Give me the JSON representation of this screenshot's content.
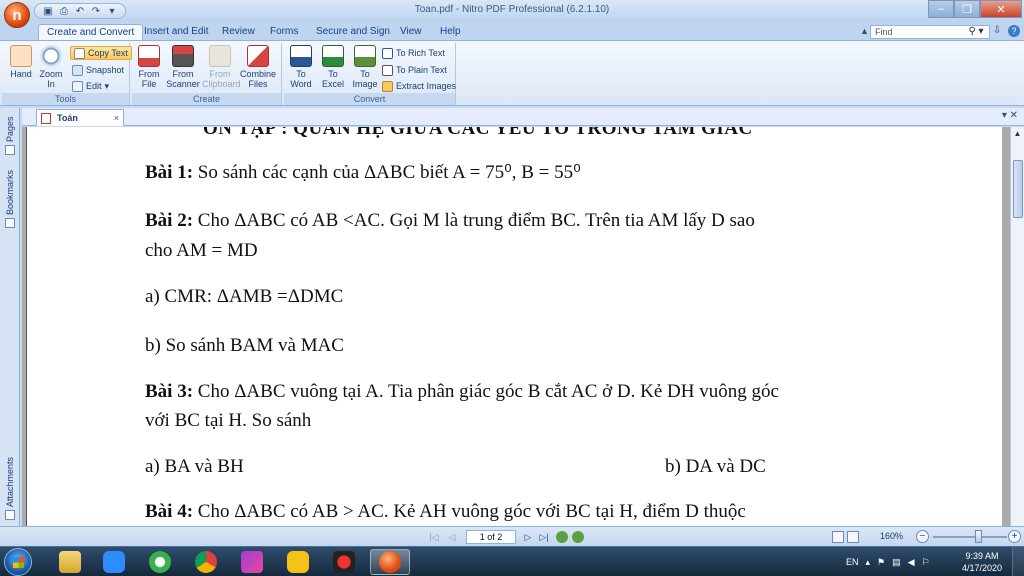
{
  "app": {
    "orb_letter": "n",
    "window_title": "Toan.pdf - Nitro PDF Professional (6.2.1.10)"
  },
  "ribbon_tabs": [
    "Create and Convert",
    "Insert and Edit",
    "Review",
    "Forms",
    "Secure and Sign",
    "View",
    "Help"
  ],
  "find": {
    "placeholder": "Find"
  },
  "ribbon": {
    "tools": {
      "label": "Tools",
      "hand": "Hand",
      "zoom_in": "Zoom In",
      "copy_text": "Copy Text",
      "snapshot": "Snapshot",
      "edit": "Edit"
    },
    "create": {
      "label": "Create",
      "from_file": "From File",
      "from_scanner": "From Scanner",
      "from_clipboard": "From Clipboard",
      "combine_files": "Combine Files"
    },
    "convert": {
      "label": "Convert",
      "to_word": "To Word",
      "to_excel": "To Excel",
      "to_image": "To Image",
      "to_rich_text": "To Rich Text",
      "to_plain_text": "To Plain Text",
      "extract_images": "Extract Images"
    }
  },
  "document_tab": {
    "name": "Toán",
    "close": "×"
  },
  "side_tabs": {
    "pages": "Pages",
    "bookmarks": "Bookmarks",
    "attachments": "Attachments"
  },
  "document": {
    "heading": "ÔN TẬP : QUAN HỆ GIỮA CÁC YẾU TỐ TRONG TAM GIÁC",
    "lines": {
      "bai1_label": "Bài 1:",
      "bai1_text": " So sánh các cạnh của  ΔABC  biết  A = 75⁰, B = 55⁰",
      "bai2_label": "Bài 2:",
      "bai2_text": " Cho  ΔABC  có AB <AC. Gọi M là trung điểm BC. Trên tia AM lấy D sao",
      "bai2_cont": "cho AM = MD",
      "a2": "a) CMR:  ΔAMB =ΔDMC",
      "b2": "b) So sánh  BAM  và  MAC",
      "bai3_label": "Bài 3:",
      "bai3_text": " Cho  ΔABC vuông tại A. Tia phân giác góc B cắt AC ở D. Kẻ DH vuông góc",
      "bai3_cont": "với BC tại H. So sánh",
      "a3": "a) BA và BH",
      "b3": "b)  DA và DC",
      "bai4_label": "Bài 4:",
      "bai4_text": " Cho ΔABC  có AB > AC. Kẻ AH vuông góc với BC tại H, điểm D thuộc"
    }
  },
  "status": {
    "page_indicator": "1 of 2",
    "zoom": "160%",
    "zoom_level_fraction": 0.62
  },
  "taskbar": {
    "language": "EN",
    "time": "9:39 AM",
    "date": "4/17/2020"
  },
  "colors": {
    "accent": "#15428b",
    "ribbon_bg": "#dbe7f6",
    "taskbar": "#16293d"
  }
}
